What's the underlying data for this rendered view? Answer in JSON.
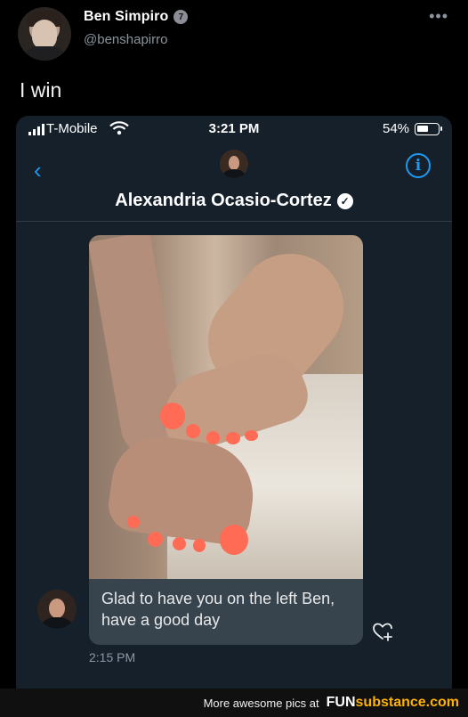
{
  "tweet": {
    "display_name": "Ben Simpiro",
    "badge_text": "7",
    "handle": "@benshapirro",
    "more_icon": "ellipsis-icon",
    "text": "I win"
  },
  "phone": {
    "status_bar": {
      "carrier": "T-Mobile",
      "time": "3:21 PM",
      "battery_percent": "54%"
    },
    "conversation": {
      "contact_name": "Alexandria Ocasio-Cortez",
      "back_icon": "chevron-left-icon",
      "info_icon": "info-icon"
    },
    "message": {
      "text": "Glad to have you on the left Ben, have a good day",
      "time": "2:15 PM",
      "reaction_icon": "heart-plus-icon"
    },
    "colors": {
      "background": "#15202b",
      "accent": "#1d9bf0",
      "bubble": "#38444d"
    }
  },
  "watermark": {
    "text": "More awesome pics at",
    "brand_prefix": "FUN",
    "brand_suffix": "substance.com"
  }
}
